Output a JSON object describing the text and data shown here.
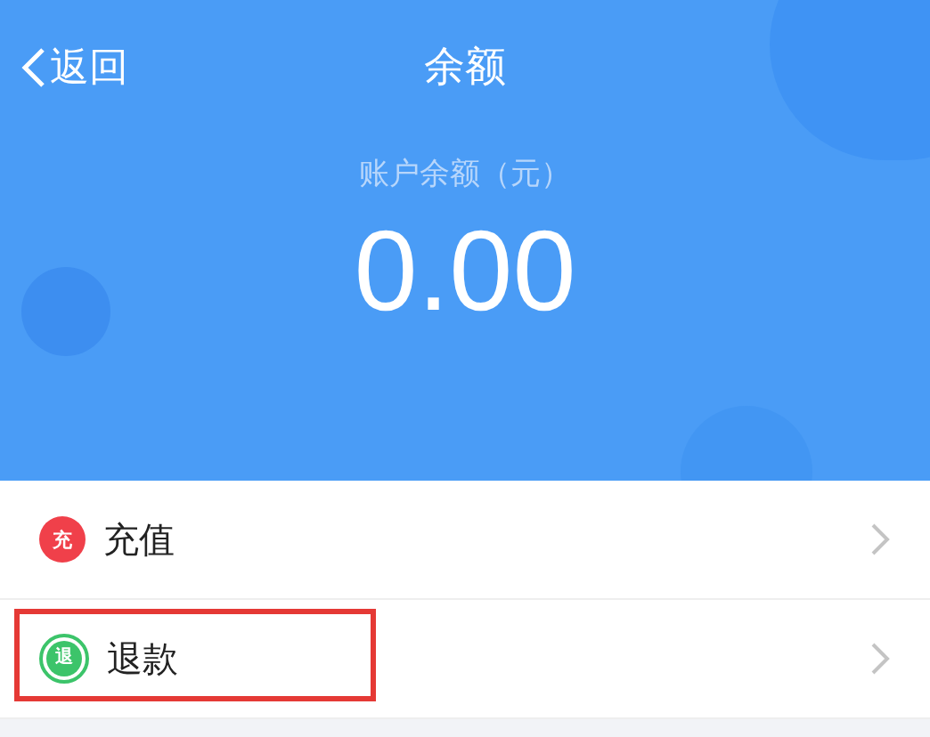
{
  "nav": {
    "back": "返回",
    "title": "余额"
  },
  "balance": {
    "label": "账户余额（元）",
    "amount": "0.00"
  },
  "items": [
    {
      "icon_text": "充",
      "label": "充值",
      "color": "#f0404a",
      "kind": "badge",
      "highlighted": false
    },
    {
      "icon_text": "退",
      "label": "退款",
      "color": "#3cc46a",
      "kind": "ring",
      "highlighted": true
    }
  ]
}
